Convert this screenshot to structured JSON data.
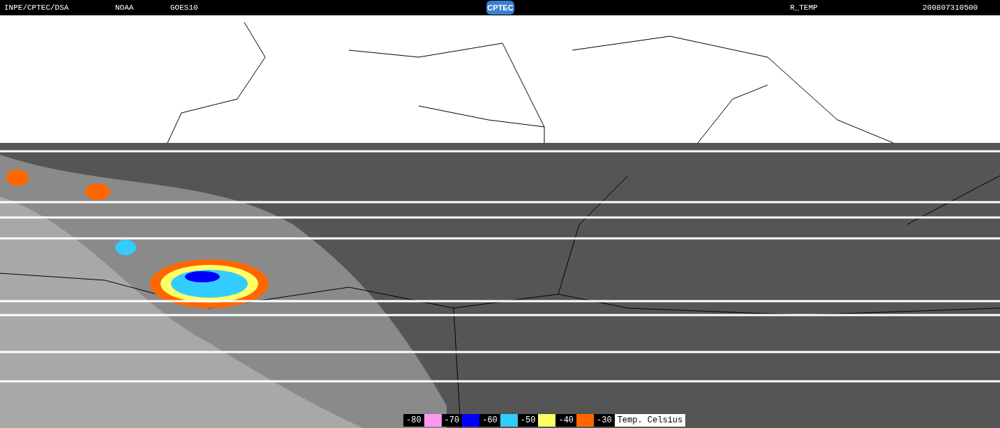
{
  "header": {
    "items": [
      "INPE/CPTEC/DSA",
      "NOAA",
      "GOES10",
      "R_TEMP",
      "200807310500"
    ],
    "logo": "CPTEC"
  },
  "legend": {
    "steps": [
      {
        "label": "-80",
        "color": "#ff99ee"
      },
      {
        "label": "-70",
        "color": "#0000ff"
      },
      {
        "label": "-60",
        "color": "#33ccff"
      },
      {
        "label": "-50",
        "color": "#ffff66"
      },
      {
        "label": "-40",
        "color": "#ff6600"
      },
      {
        "label": "-30"
      }
    ],
    "caption": "Temp. Celsius"
  }
}
